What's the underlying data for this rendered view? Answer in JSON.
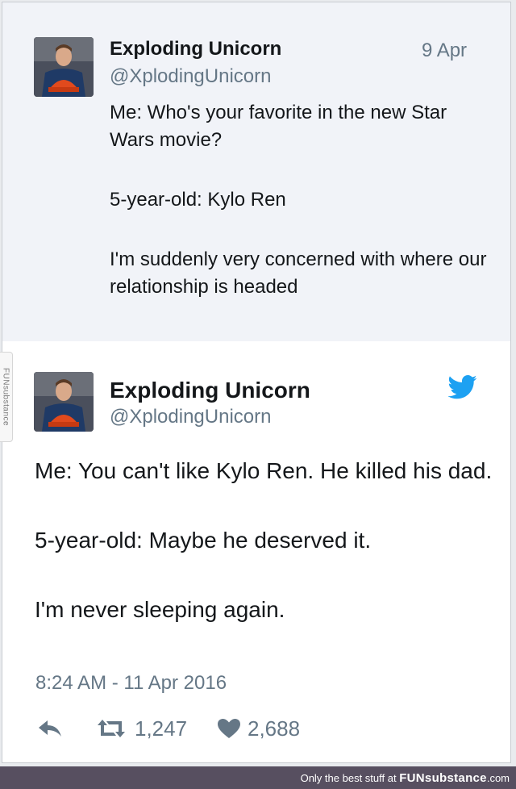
{
  "colors": {
    "twitter_blue": "#1da1f2",
    "muted": "#657786",
    "footer_bg": "#574f60"
  },
  "parent_tweet": {
    "author_name": "Exploding Unicorn",
    "handle": "@XplodingUnicorn",
    "date": "9 Apr",
    "paragraphs": [
      "Me: Who's your favorite in the new Star Wars movie?",
      "5-year-old: Kylo Ren",
      "I'm suddenly very concerned with where our relationship is headed"
    ]
  },
  "main_tweet": {
    "author_name": "Exploding Unicorn",
    "handle": "@XplodingUnicorn",
    "icon": "twitter-bird-icon",
    "paragraphs": [
      "Me: You can't like Kylo Ren. He killed his dad.",
      "5-year-old: Maybe he deserved it.",
      "I'm never sleeping again."
    ],
    "timestamp": "8:24 AM - 11 Apr 2016",
    "retweets": "1,247",
    "likes": "2,688"
  },
  "watermark": {
    "side_tab": "FUNsubstance",
    "footer_prefix": "Only the best stuff at",
    "footer_brand": "FUNsubstance",
    "footer_suffix": ".com"
  }
}
